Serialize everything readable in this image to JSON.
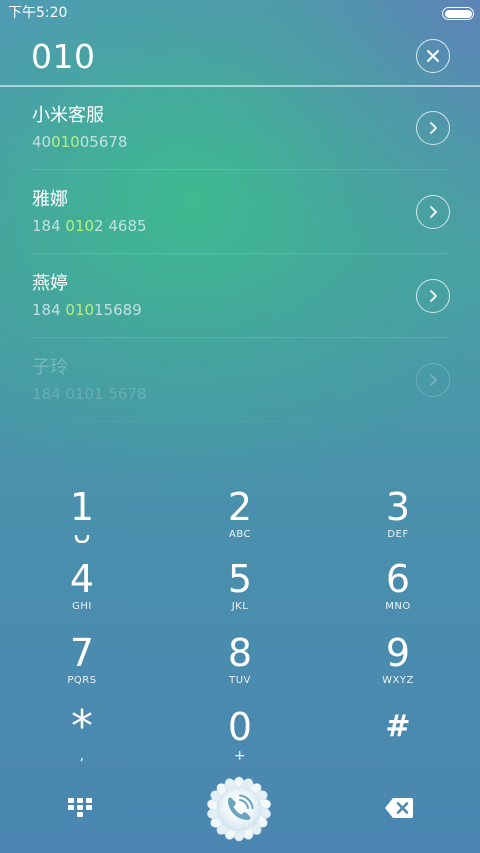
{
  "status_bar": {
    "time": "下午5:20",
    "battery_level": 1.0
  },
  "dialer": {
    "input_value": "010",
    "clear_icon": "close-icon"
  },
  "contacts": [
    {
      "name": "小米客服",
      "number_parts": [
        {
          "text": "40",
          "match": false
        },
        {
          "text": "010",
          "match": true
        },
        {
          "text": "05678",
          "match": false
        }
      ],
      "faded": false
    },
    {
      "name": "雅娜",
      "number_parts": [
        {
          "text": "184 ",
          "match": false
        },
        {
          "text": "010",
          "match": true
        },
        {
          "text": "2 4685",
          "match": false
        }
      ],
      "faded": false
    },
    {
      "name": "燕婷",
      "number_parts": [
        {
          "text": "184 ",
          "match": false
        },
        {
          "text": "010",
          "match": true
        },
        {
          "text": "15689",
          "match": false
        }
      ],
      "faded": false
    },
    {
      "name": "子玲",
      "number_parts": [
        {
          "text": "184 0101 5678",
          "match": false
        }
      ],
      "faded": true
    }
  ],
  "keypad": [
    {
      "digit": "1",
      "letters": "",
      "icon": "voicemail-icon"
    },
    {
      "digit": "2",
      "letters": "ABC"
    },
    {
      "digit": "3",
      "letters": "DEF"
    },
    {
      "digit": "4",
      "letters": "GHI"
    },
    {
      "digit": "5",
      "letters": "JKL"
    },
    {
      "digit": "6",
      "letters": "MNO"
    },
    {
      "digit": "7",
      "letters": "PQRS"
    },
    {
      "digit": "8",
      "letters": "TUV"
    },
    {
      "digit": "9",
      "letters": "WXYZ"
    },
    {
      "digit": "*",
      "letters": ","
    },
    {
      "digit": "0",
      "letters": "+"
    },
    {
      "digit": "#",
      "letters": ""
    }
  ],
  "bottom_bar": {
    "keypad_toggle_icon": "dialpad-icon",
    "call_icon": "phone-call-icon",
    "delete_icon": "backspace-icon"
  },
  "colors": {
    "match_highlight": "#b5ef82",
    "text": "#ffffff"
  }
}
